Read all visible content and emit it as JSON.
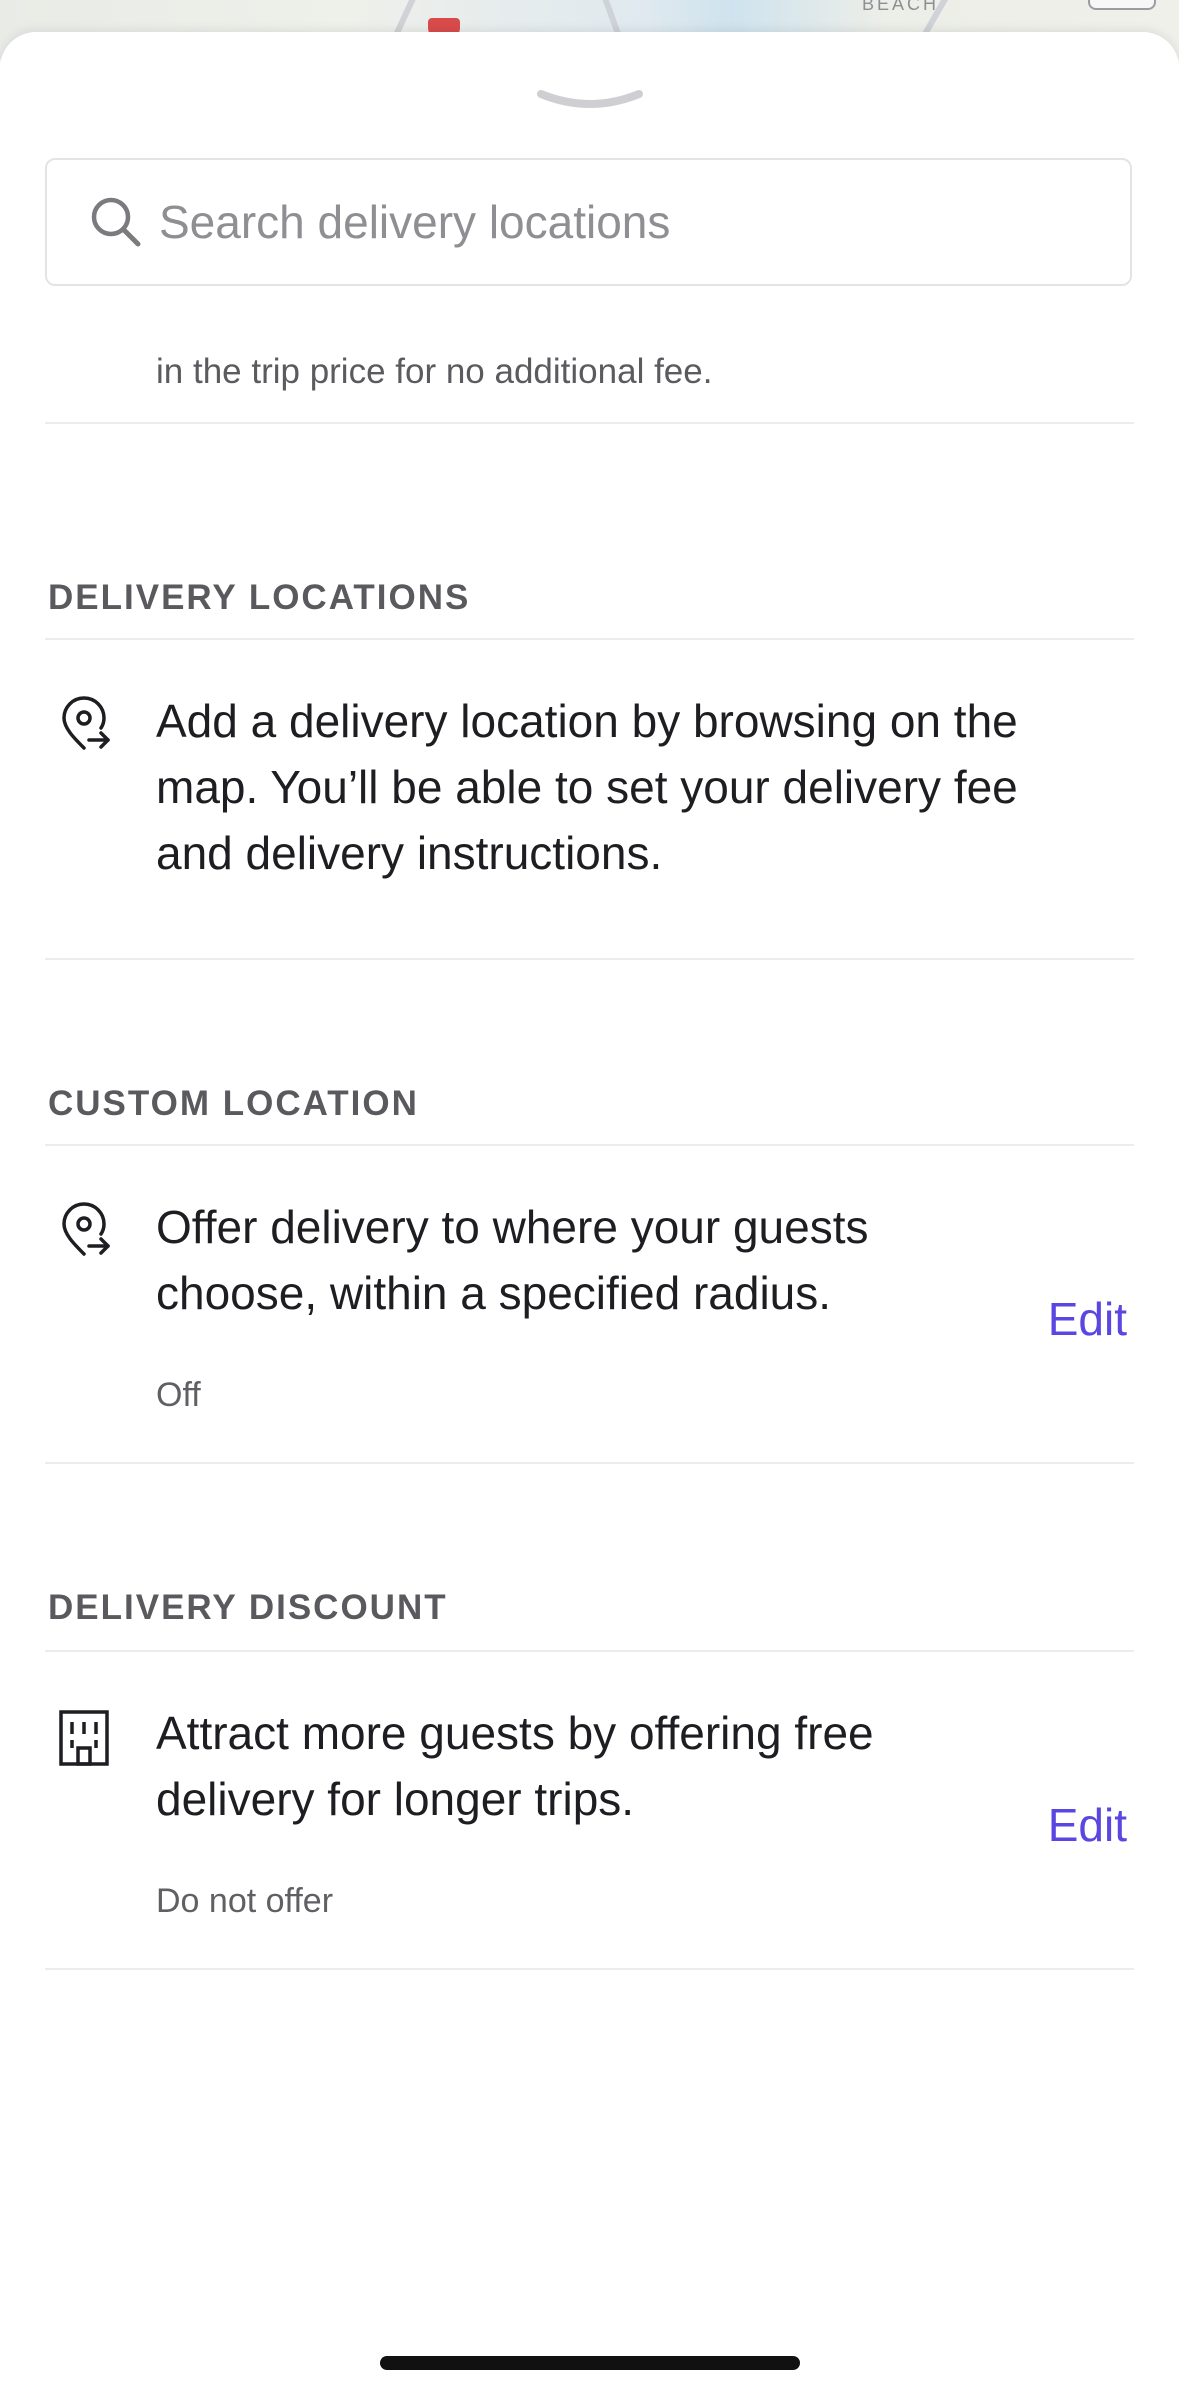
{
  "map": {
    "label": "BEACH"
  },
  "search": {
    "placeholder": "Search delivery locations"
  },
  "intro": {
    "cut_text": "in the trip price for no additional fee."
  },
  "sections": {
    "delivery_locations": {
      "title": "DELIVERY LOCATIONS",
      "text": "Add a delivery location by browsing on the map. You’ll be able to set your delivery fee and delivery instructions."
    },
    "custom_location": {
      "title": "CUSTOM LOCATION",
      "text": "Offer delivery to where your guests choose, within a specified radius.",
      "status": "Off",
      "edit_label": "Edit"
    },
    "delivery_discount": {
      "title": "DELIVERY DISCOUNT",
      "text": "Attract more guests by offering free delivery for longer trips.",
      "status": "Do not offer",
      "edit_label": "Edit"
    }
  },
  "colors": {
    "accent": "#5a46e0",
    "section_title": "#5a5a5e",
    "body_text": "#1e1e22",
    "divider": "#ececec"
  },
  "icons": {
    "search": "search-icon",
    "location_pin_arrow": "location-pin-arrow-icon",
    "building": "building-icon"
  }
}
